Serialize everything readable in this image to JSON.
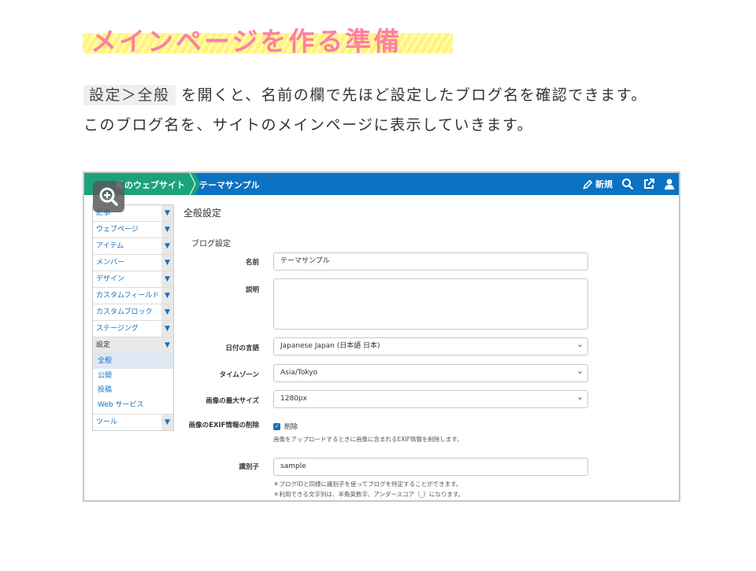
{
  "heading": {
    "title": "メインページを作る準備"
  },
  "intro": {
    "code": "設定＞全般",
    "line1_rest": "を開くと、名前の欄で先ほど設定したブログ名を確認できます。",
    "line2": "このブログ名を、サイトのメインページに表示していきます。"
  },
  "topbar": {
    "site_name": "私のウェブサイト",
    "breadcrumb": "テーマサンプル",
    "new_label": "新規",
    "colors": {
      "bar": "#0c72c2",
      "site": "#1aa37a"
    }
  },
  "sidebar": {
    "items": [
      {
        "label": "記事"
      },
      {
        "label": "ウェブページ"
      },
      {
        "label": "アイテム"
      },
      {
        "label": "メンバー"
      },
      {
        "label": "デザイン"
      },
      {
        "label": "カスタムフィールド"
      },
      {
        "label": "カスタムブロック"
      },
      {
        "label": "ステージング"
      },
      {
        "label": "設定"
      },
      {
        "label": "ツール"
      }
    ],
    "caret": "▼",
    "sub_items": [
      {
        "label": "全般"
      },
      {
        "label": "公開"
      },
      {
        "label": "投稿"
      },
      {
        "label": "Web サービス"
      }
    ]
  },
  "main": {
    "title": "全般設定",
    "section": "ブログ設定",
    "fields": {
      "name": {
        "label": "名前",
        "value": "テーマサンプル"
      },
      "description": {
        "label": "説明",
        "value": ""
      },
      "date_language": {
        "label": "日付の言語",
        "value": "Japanese Japan (日本語 日本)"
      },
      "timezone": {
        "label": "タイムゾーン",
        "value": "Asia/Tokyo"
      },
      "max_image_size": {
        "label": "画像の最大サイズ",
        "value": "1280px"
      },
      "exif": {
        "label": "画像のEXIF情報の削除",
        "checkbox_label": "削除",
        "checked": true,
        "help": "画像をアップロードするときに画像に含まれるEXIF情報を削除します。"
      },
      "identifier": {
        "label": "識別子",
        "value": "sample",
        "help1": "＊ブログIDと同様に識別子を使ってブログを特定することができます。",
        "help2": "＊利用できる文字列は、半角英数字、アンダースコア（_）になります。"
      }
    }
  }
}
